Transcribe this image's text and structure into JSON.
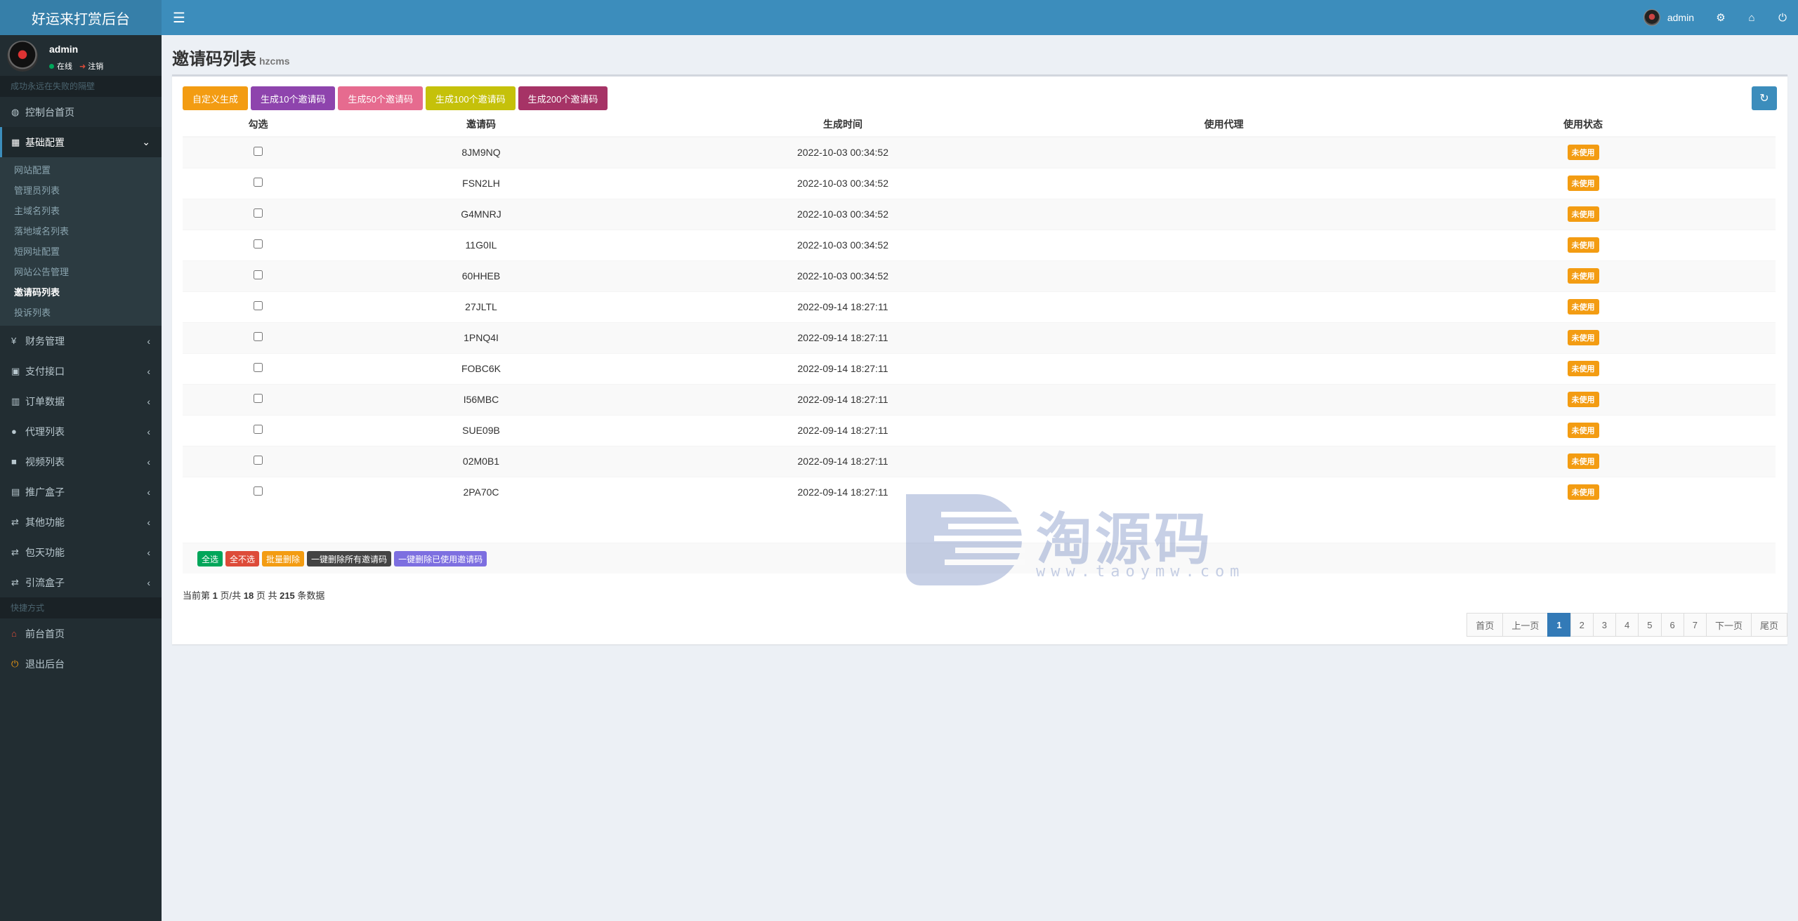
{
  "app": {
    "title": "好运来打赏后台"
  },
  "header": {
    "username": "admin"
  },
  "sidebar": {
    "user": {
      "name": "admin",
      "online": "在线",
      "logout": "注销"
    },
    "section_main": "成功永远在失败的隔壁",
    "items": [
      {
        "label": "控制台首页",
        "icon": "◍"
      },
      {
        "label": "基础配置",
        "icon": "▦"
      }
    ],
    "submenu": [
      "网站配置",
      "管理员列表",
      "主域名列表",
      "落地域名列表",
      "短网址配置",
      "网站公告管理",
      "邀请码列表",
      "投诉列表"
    ],
    "items_after": [
      {
        "label": "财务管理",
        "icon": "¥"
      },
      {
        "label": "支付接口",
        "icon": "▣"
      },
      {
        "label": "订单数据",
        "icon": "▥"
      },
      {
        "label": "代理列表",
        "icon": "●"
      },
      {
        "label": "视频列表",
        "icon": "■"
      },
      {
        "label": "推广盒子",
        "icon": "▤"
      },
      {
        "label": "其他功能",
        "icon": "⇄"
      },
      {
        "label": "包天功能",
        "icon": "⇄"
      },
      {
        "label": "引流盒子",
        "icon": "⇄"
      }
    ],
    "section_quick": "快捷方式",
    "quick": [
      {
        "label": "前台首页",
        "icon": "⌂"
      },
      {
        "label": "退出后台",
        "icon": "⏻"
      }
    ]
  },
  "page": {
    "title": "邀请码列表",
    "subtitle": "hzcms"
  },
  "toolbar": {
    "buttons": [
      {
        "label": "自定义生成",
        "color": "#f39c12"
      },
      {
        "label": "生成10个邀请码",
        "color": "#8e44ad"
      },
      {
        "label": "生成50个邀请码",
        "color": "#e66b8f"
      },
      {
        "label": "生成100个邀请码",
        "color": "#c5c10a"
      },
      {
        "label": "生成200个邀请码",
        "color": "#a63366"
      }
    ]
  },
  "table": {
    "headers": [
      "勾选",
      "邀请码",
      "生成时间",
      "使用代理",
      "使用状态"
    ],
    "rows": [
      {
        "code": "8JM9NQ",
        "time": "2022-10-03 00:34:52",
        "agent": "",
        "status": "未使用"
      },
      {
        "code": "FSN2LH",
        "time": "2022-10-03 00:34:52",
        "agent": "",
        "status": "未使用"
      },
      {
        "code": "G4MNRJ",
        "time": "2022-10-03 00:34:52",
        "agent": "",
        "status": "未使用"
      },
      {
        "code": "11G0IL",
        "time": "2022-10-03 00:34:52",
        "agent": "",
        "status": "未使用"
      },
      {
        "code": "60HHEB",
        "time": "2022-10-03 00:34:52",
        "agent": "",
        "status": "未使用"
      },
      {
        "code": "27JLTL",
        "time": "2022-09-14 18:27:11",
        "agent": "",
        "status": "未使用"
      },
      {
        "code": "1PNQ4I",
        "time": "2022-09-14 18:27:11",
        "agent": "",
        "status": "未使用"
      },
      {
        "code": "FOBC6K",
        "time": "2022-09-14 18:27:11",
        "agent": "",
        "status": "未使用"
      },
      {
        "code": "I56MBC",
        "time": "2022-09-14 18:27:11",
        "agent": "",
        "status": "未使用"
      },
      {
        "code": "SUE09B",
        "time": "2022-09-14 18:27:11",
        "agent": "",
        "status": "未使用"
      },
      {
        "code": "02M0B1",
        "time": "2022-09-14 18:27:11",
        "agent": "",
        "status": "未使用"
      },
      {
        "code": "2PA70C",
        "time": "2022-09-14 18:27:11",
        "agent": "",
        "status": "未使用"
      }
    ]
  },
  "bulk": {
    "buttons": [
      {
        "label": "全选",
        "color": "#00a65a"
      },
      {
        "label": "全不选",
        "color": "#dd4b39"
      },
      {
        "label": "批量删除",
        "color": "#f39c12"
      },
      {
        "label": "一键删除所有邀请码",
        "color": "#444444"
      },
      {
        "label": "一键删除已使用邀请码",
        "color": "#7d6fe0"
      }
    ]
  },
  "pager": {
    "prefix": "当前第",
    "current": "1",
    "mid1": "页/共",
    "total_pages": "18",
    "mid2": "页 共",
    "total_records": "215",
    "suffix": "条数据",
    "first": "首页",
    "prev": "上一页",
    "pages": [
      "1",
      "2",
      "3",
      "4",
      "5",
      "6",
      "7"
    ],
    "next": "下一页",
    "last": "尾页"
  },
  "watermark": {
    "text": "淘源码",
    "url": "www.taoymw.com"
  }
}
